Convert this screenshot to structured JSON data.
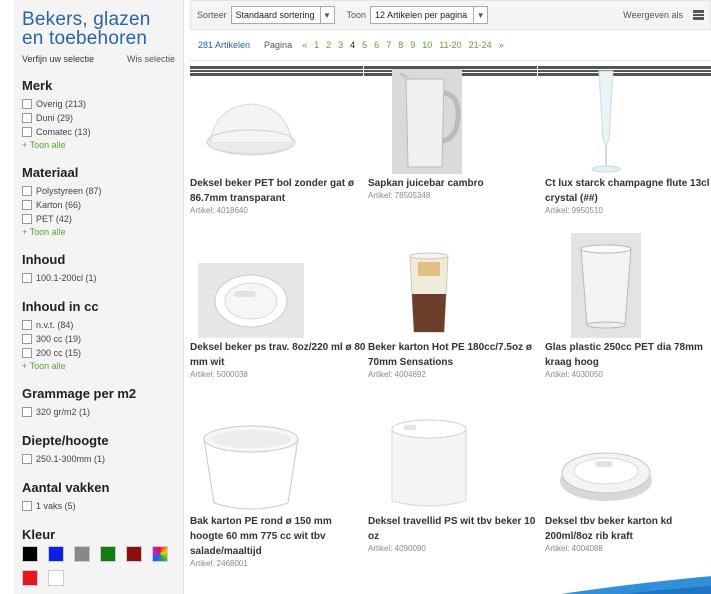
{
  "sidebar": {
    "title": "Bekers, glazen en toebehoren",
    "refine_label": "Verfijn uw selectie",
    "clear_label": "Wis selectie",
    "facets": [
      {
        "title": "Merk",
        "options": [
          "Overig (213)",
          "Duni (29)",
          "Comatec (13)"
        ],
        "more": "+ Toon alle"
      },
      {
        "title": "Materiaal",
        "options": [
          "Polystyreen (87)",
          "Karton (66)",
          "PET (42)"
        ],
        "more": "+ Toon alle"
      },
      {
        "title": "Inhoud",
        "options": [
          "100.1-200cl (1)"
        ],
        "more": ""
      },
      {
        "title": "Inhoud in cc",
        "options": [
          "n.v.t. (84)",
          "300 cc (19)",
          "200 cc (15)"
        ],
        "more": "+ Toon alle"
      },
      {
        "title": "Grammage per m2",
        "options": [
          "320 gr/m2 (1)"
        ],
        "more": ""
      },
      {
        "title": "Diepte/hoogte",
        "options": [
          "250.1-300mm (1)"
        ],
        "more": ""
      },
      {
        "title": "Aantal vakken",
        "options": [
          "1 vaks (5)"
        ],
        "more": ""
      }
    ],
    "color_title": "Kleur",
    "colors": [
      "#000000",
      "#0a1fe8",
      "#888888",
      "#127c12",
      "#8a0f0f",
      "multi",
      "#e8141e",
      "#ffffff"
    ]
  },
  "toolbar": {
    "sort_label": "Sorteer",
    "sort_value": "Standaard sortering",
    "show_label": "Toon",
    "show_value": "12 Artikelen per pagina",
    "view_label": "Weergeven als"
  },
  "pager": {
    "count": "281 Artikelen",
    "page_label": "Pagina",
    "items": [
      "«",
      "1",
      "2",
      "3",
      "4",
      "5",
      "6",
      "7",
      "8",
      "9",
      "10",
      "11-20",
      "21-24",
      "»"
    ],
    "current": "4"
  },
  "products": [
    {
      "name": "Deksel beker PET bol zonder gat ø 86.7mm transparant",
      "article": "Artikel: 4018640",
      "icon": "dome-lid"
    },
    {
      "name": "Sapkan juicebar cambro",
      "article": "Artikel: 78505348",
      "icon": "pitcher"
    },
    {
      "name": "Ct lux starck champagne flute 13cl crystal (##)",
      "article": "Artikel: 9950510",
      "icon": "flute"
    },
    {
      "name": "Deksel beker ps trav. 8oz/220 ml ø 80 mm wit",
      "article": "Artikel: 5000038",
      "icon": "white-lid"
    },
    {
      "name": "Beker karton Hot PE 180cc/7.5oz ø 70mm Sensations",
      "article": "Artikel: 4004692",
      "icon": "paper-cup"
    },
    {
      "name": "Glas plastic 250cc PET dia 78mm kraag hoog",
      "article": "Artikel: 4030050",
      "icon": "plastic-glass"
    },
    {
      "name": "Bak karton PE rond ø 150 mm hoogte 60 mm 775 cc wit tbv salade/maaltijd",
      "article": "Artikel: 2468001",
      "icon": "bowl"
    },
    {
      "name": "Deksel travellid PS wit tbv beker 10 oz",
      "article": "Artikel: 4090090",
      "icon": "travel-lid"
    },
    {
      "name": "Deksel tbv beker karton kd 200ml/8oz rib kraft",
      "article": "Artikel: 4004088",
      "icon": "rib-lid"
    }
  ]
}
